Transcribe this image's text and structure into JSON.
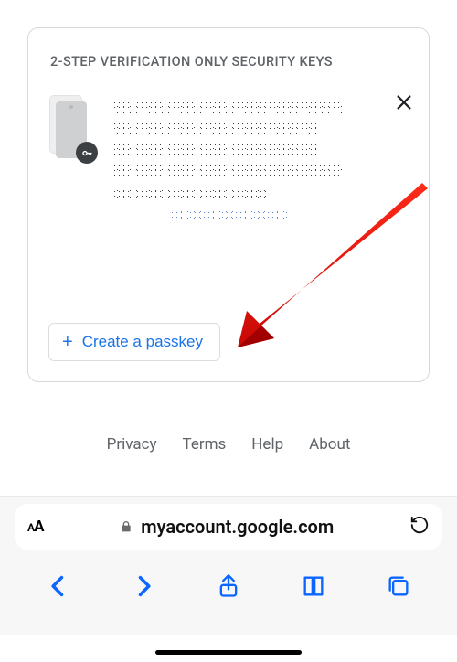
{
  "card": {
    "title": "2-STEP VERIFICATION ONLY SECURITY KEYS",
    "create_button": "Create a passkey"
  },
  "footer": {
    "privacy": "Privacy",
    "terms": "Terms",
    "help": "Help",
    "about": "About"
  },
  "browser": {
    "domain": "myaccount.google.com"
  },
  "colors": {
    "link_blue": "#1a73e8",
    "safari_blue": "#0a66ff",
    "text_gray": "#5f6368"
  }
}
